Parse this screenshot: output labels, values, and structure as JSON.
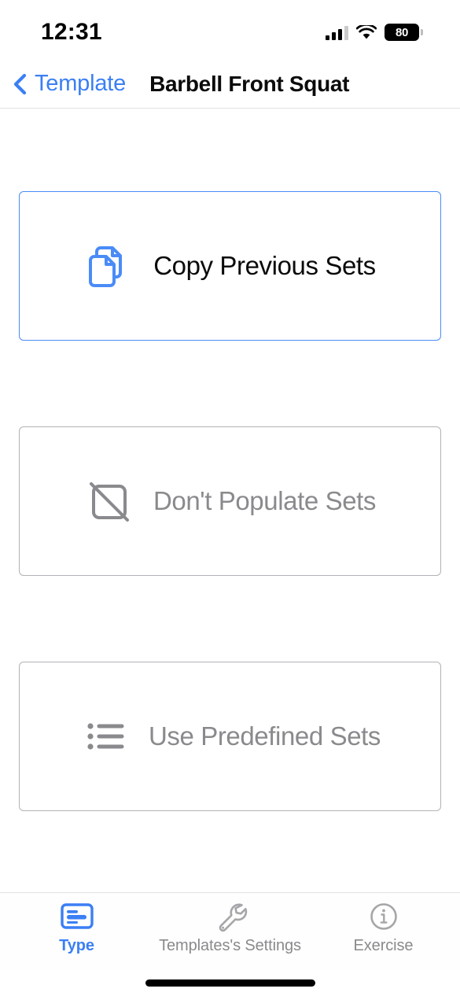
{
  "status_bar": {
    "time": "12:31",
    "cellular_icon": "cellular-bars-icon",
    "wifi_icon": "wifi-icon",
    "battery_icon": "battery-icon",
    "battery_level": "80"
  },
  "nav_bar": {
    "back_icon": "chevron-left-icon",
    "back_label": "Template",
    "title": "Barbell Front Squat"
  },
  "main": {
    "options": [
      {
        "id": "copy-previous-sets",
        "label": "Copy Previous Sets",
        "icon": "copy-documents-icon",
        "selected": true
      },
      {
        "id": "dont-populate-sets",
        "label": "Don't Populate Sets",
        "icon": "slashed-square-icon",
        "selected": false
      },
      {
        "id": "use-predefined-sets",
        "label": "Use Predefined Sets",
        "icon": "bulleted-list-icon",
        "selected": false
      }
    ]
  },
  "tab_bar": {
    "tabs": [
      {
        "id": "type",
        "label": "Type",
        "icon": "card-list-icon",
        "active": true
      },
      {
        "id": "settings",
        "label": "Templates's Settings",
        "icon": "wrench-icon",
        "active": false
      },
      {
        "id": "exercise",
        "label": "Exercise",
        "icon": "info-circle-icon",
        "active": false
      }
    ]
  },
  "colors": {
    "accent_blue": "#3b7ff5",
    "icon_blue": "#4a8cf7",
    "muted_gray": "#8a8a8e",
    "border_gray": "#b3b3b8",
    "separator": "#e2e2e5"
  }
}
